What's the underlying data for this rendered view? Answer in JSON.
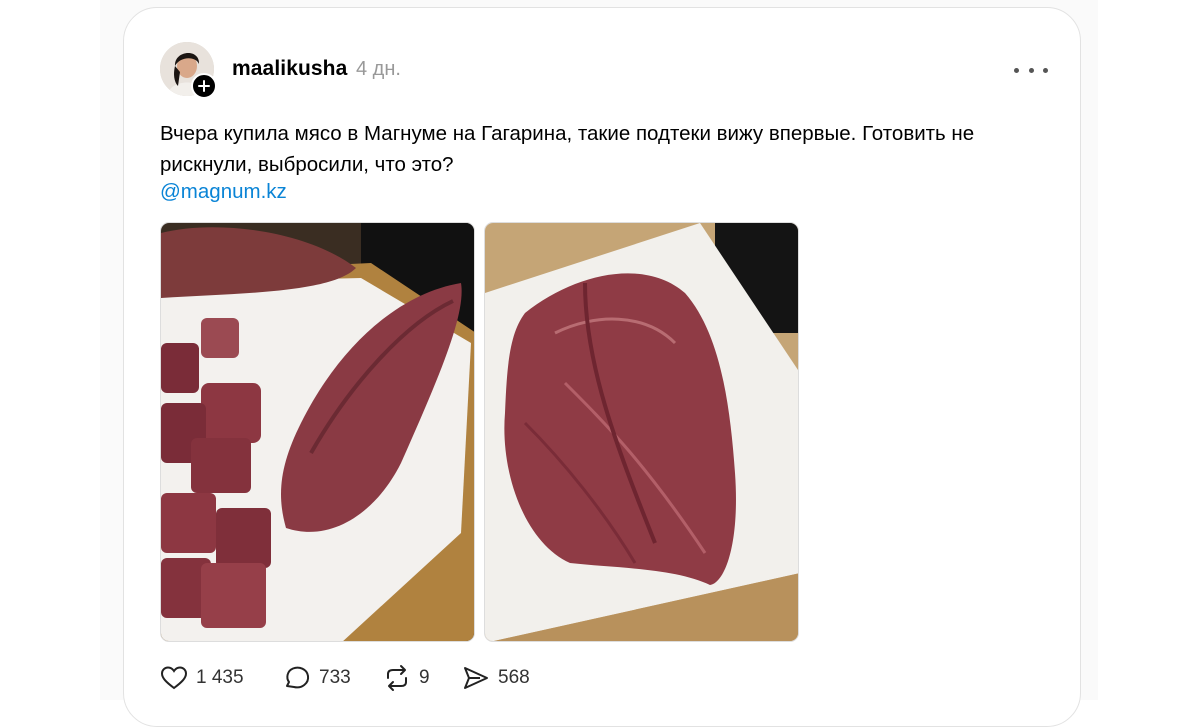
{
  "post": {
    "username": "maalikusha",
    "timestamp": "4 дн.",
    "text": "Вчера купила мясо в Магнуме на Гагарина, такие подтеки вижу впервые. Готовить не рискнули, выбросили, что это?",
    "mention": "@magnum.kz"
  },
  "actions": {
    "likes": "1 435",
    "comments": "733",
    "reposts": "9",
    "shares": "568"
  },
  "icons": {
    "like": "heart-icon",
    "comment": "speech-bubble-icon",
    "repost": "repost-arrows-icon",
    "share": "send-icon",
    "more": "more-dots-icon",
    "follow": "plus-icon"
  }
}
